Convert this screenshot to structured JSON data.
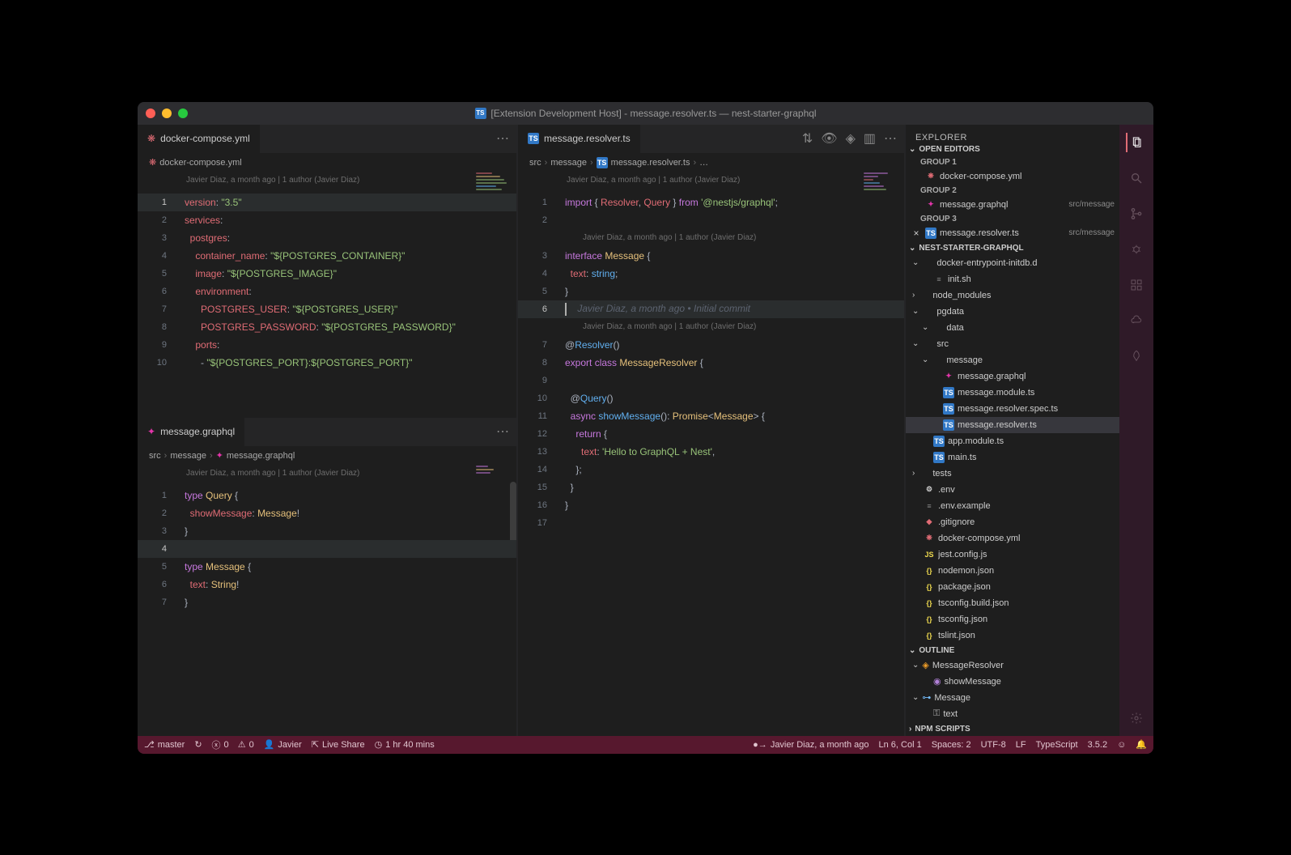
{
  "window": {
    "title": "[Extension Development Host] - message.resolver.ts — nest-starter-graphql"
  },
  "left_top_editor": {
    "tab_label": "docker-compose.yml",
    "breadcrumb": [
      "docker-compose.yml"
    ],
    "lens": "Javier Diaz, a month ago | 1 author (Javier Diaz)",
    "lines": [
      {
        "n": 1,
        "html": "<span class='k-red'>version</span><span class='k-white'>:</span> <span class='k-green'>\"3.5\"</span>",
        "active": true
      },
      {
        "n": 2,
        "html": "<span class='k-red'>services</span><span class='k-white'>:</span>"
      },
      {
        "n": 3,
        "html": "  <span class='k-red'>postgres</span><span class='k-white'>:</span>"
      },
      {
        "n": 4,
        "html": "    <span class='k-red'>container_name</span><span class='k-white'>:</span> <span class='k-green'>\"${POSTGRES_CONTAINER}\"</span>"
      },
      {
        "n": 5,
        "html": "    <span class='k-red'>image</span><span class='k-white'>:</span> <span class='k-green'>\"${POSTGRES_IMAGE}\"</span>"
      },
      {
        "n": 6,
        "html": "    <span class='k-red'>environment</span><span class='k-white'>:</span>"
      },
      {
        "n": 7,
        "html": "      <span class='k-red'>POSTGRES_USER</span><span class='k-white'>:</span> <span class='k-green'>\"${POSTGRES_USER}\"</span>"
      },
      {
        "n": 8,
        "html": "      <span class='k-red'>POSTGRES_PASSWORD</span><span class='k-white'>:</span> <span class='k-green'>\"${POSTGRES_PASSWORD}\"</span>"
      },
      {
        "n": 9,
        "html": "    <span class='k-red'>ports</span><span class='k-white'>:</span>"
      },
      {
        "n": 10,
        "html": "      - <span class='k-green'>\"${POSTGRES_PORT}:${POSTGRES_PORT}\"</span>"
      }
    ]
  },
  "left_bottom_editor": {
    "tab_label": "message.graphql",
    "breadcrumb": [
      "src",
      "message",
      "message.graphql"
    ],
    "lens": "Javier Diaz, a month ago | 1 author (Javier Diaz)",
    "lines": [
      {
        "n": 1,
        "html": "<span class='k-purple'>type</span> <span class='k-yellow'>Query</span> {"
      },
      {
        "n": 2,
        "html": "  <span class='k-red'>showMessage</span>: <span class='k-yellow'>Message</span>!"
      },
      {
        "n": 3,
        "html": "}"
      },
      {
        "n": 4,
        "html": "",
        "active": true
      },
      {
        "n": 5,
        "html": "<span class='k-purple'>type</span> <span class='k-yellow'>Message</span> {"
      },
      {
        "n": 6,
        "html": "  <span class='k-red'>text</span>: <span class='k-yellow'>String</span>!"
      },
      {
        "n": 7,
        "html": "}"
      }
    ]
  },
  "right_editor": {
    "tab_label": "message.resolver.ts",
    "breadcrumb": [
      "src",
      "message",
      "message.resolver.ts",
      "…"
    ],
    "lens1": "Javier Diaz, a month ago | 1 author (Javier Diaz)",
    "lens2": "Javier Diaz, a month ago | 1 author (Javier Diaz)",
    "lens3": "Javier Diaz, a month ago | 1 author (Javier Diaz)",
    "blame": "Javier Diaz, a month ago • Initial commit",
    "lines_a": [
      {
        "n": 1,
        "html": "<span class='k-purple'>import</span> { <span class='k-red'>Resolver</span>, <span class='k-red'>Query</span> } <span class='k-purple'>from</span> <span class='k-green'>'@nestjs/graphql'</span>;"
      },
      {
        "n": 2,
        "html": ""
      }
    ],
    "lines_b": [
      {
        "n": 3,
        "html": "<span class='k-purple'>interface</span> <span class='k-yellow'>Message</span> {"
      },
      {
        "n": 4,
        "html": "  <span class='k-red'>text</span>: <span class='k-cyan'>string</span>;"
      },
      {
        "n": 5,
        "html": "}"
      },
      {
        "n": 6,
        "html": "",
        "active": true,
        "cursor": true
      }
    ],
    "lines_c": [
      {
        "n": 7,
        "html": "@<span class='k-cyan'>Resolver</span>()"
      },
      {
        "n": 8,
        "html": "<span class='k-purple'>export</span> <span class='k-purple'>class</span> <span class='k-yellow'>MessageResolver</span> {"
      },
      {
        "n": 9,
        "html": ""
      },
      {
        "n": 10,
        "html": "  @<span class='k-cyan'>Query</span>()"
      },
      {
        "n": 11,
        "html": "  <span class='k-purple'>async</span> <span class='k-cyan'>showMessage</span>(): <span class='k-yellow'>Promise</span>&lt;<span class='k-yellow'>Message</span>&gt; {"
      },
      {
        "n": 12,
        "html": "    <span class='k-purple'>return</span> {"
      },
      {
        "n": 13,
        "html": "      <span class='k-red'>text</span>: <span class='k-green'>'Hello to GraphQL + Nest'</span>,"
      },
      {
        "n": 14,
        "html": "    };"
      },
      {
        "n": 15,
        "html": "  }"
      },
      {
        "n": 16,
        "html": "}"
      },
      {
        "n": 17,
        "html": ""
      }
    ]
  },
  "explorer": {
    "title": "EXPLORER",
    "open_editors_label": "OPEN EDITORS",
    "groups": [
      {
        "label": "GROUP 1",
        "items": [
          {
            "icon": "docker",
            "name": "docker-compose.yml",
            "close": false
          }
        ]
      },
      {
        "label": "GROUP 2",
        "items": [
          {
            "icon": "graphql",
            "name": "message.graphql",
            "desc": "src/message",
            "close": false
          }
        ]
      },
      {
        "label": "GROUP 3",
        "items": [
          {
            "icon": "ts",
            "name": "message.resolver.ts",
            "desc": "src/message",
            "close": true
          }
        ]
      }
    ],
    "project_label": "NEST-STARTER-GRAPHQL",
    "tree": [
      {
        "indent": 0,
        "chev": "v",
        "icon": "",
        "name": "docker-entrypoint-initdb.d"
      },
      {
        "indent": 1,
        "icon": "sh",
        "name": "init.sh"
      },
      {
        "indent": 0,
        "chev": ">",
        "icon": "",
        "name": "node_modules"
      },
      {
        "indent": 0,
        "chev": "v",
        "icon": "",
        "name": "pgdata"
      },
      {
        "indent": 1,
        "chev": "v",
        "icon": "",
        "name": "data"
      },
      {
        "indent": 0,
        "chev": "v",
        "icon": "",
        "name": "src"
      },
      {
        "indent": 1,
        "chev": "v",
        "icon": "",
        "name": "message"
      },
      {
        "indent": 2,
        "icon": "graphql",
        "name": "message.graphql"
      },
      {
        "indent": 2,
        "icon": "ts",
        "name": "message.module.ts"
      },
      {
        "indent": 2,
        "icon": "ts",
        "name": "message.resolver.spec.ts"
      },
      {
        "indent": 2,
        "icon": "ts",
        "name": "message.resolver.ts",
        "selected": true
      },
      {
        "indent": 1,
        "icon": "ts",
        "name": "app.module.ts"
      },
      {
        "indent": 1,
        "icon": "ts",
        "name": "main.ts"
      },
      {
        "indent": 0,
        "chev": ">",
        "icon": "",
        "name": "tests"
      },
      {
        "indent": 0,
        "icon": "gear",
        "name": ".env"
      },
      {
        "indent": 0,
        "icon": "sh",
        "name": ".env.example"
      },
      {
        "indent": 0,
        "icon": "git",
        "name": ".gitignore"
      },
      {
        "indent": 0,
        "icon": "docker",
        "name": "docker-compose.yml"
      },
      {
        "indent": 0,
        "icon": "js",
        "name": "jest.config.js"
      },
      {
        "indent": 0,
        "icon": "json",
        "name": "nodemon.json"
      },
      {
        "indent": 0,
        "icon": "json",
        "name": "package.json"
      },
      {
        "indent": 0,
        "icon": "json",
        "name": "tsconfig.build.json"
      },
      {
        "indent": 0,
        "icon": "json",
        "name": "tsconfig.json"
      },
      {
        "indent": 0,
        "icon": "json",
        "name": "tslint.json"
      }
    ],
    "outline_label": "OUTLINE",
    "outline": [
      {
        "indent": 0,
        "chev": "v",
        "sym": "class",
        "name": "MessageResolver"
      },
      {
        "indent": 1,
        "sym": "method",
        "name": "showMessage"
      },
      {
        "indent": 0,
        "chev": "v",
        "sym": "interface",
        "name": "Message"
      },
      {
        "indent": 1,
        "sym": "field",
        "name": "text"
      }
    ],
    "npm_label": "NPM SCRIPTS"
  },
  "statusbar": {
    "branch": "master",
    "errors": "0",
    "warnings": "0",
    "user": "Javier",
    "liveshare": "Live Share",
    "time": "1 hr 40 mins",
    "blame": "Javier Diaz, a month ago",
    "lncol": "Ln 6, Col 1",
    "spaces": "Spaces: 2",
    "encoding": "UTF-8",
    "eol": "LF",
    "lang": "TypeScript",
    "version": "3.5.2"
  }
}
